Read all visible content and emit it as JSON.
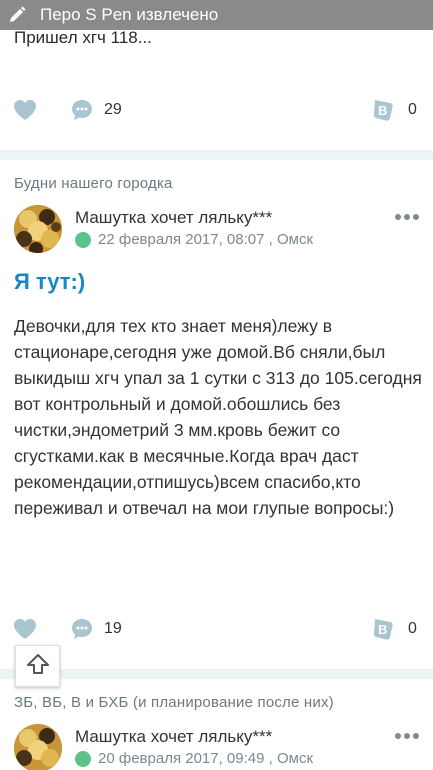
{
  "toast": {
    "text": "Перо S Pen извлечено",
    "icon": "pen-icon"
  },
  "prev_post": {
    "text": "Пришел хгч 118...",
    "comments": "29",
    "votes": "0"
  },
  "post": {
    "category": "Будни нашего городка",
    "author": "Машутка хочет ляльку***",
    "meta": "22 февраля 2017, 08:07 , Омск",
    "title": "Я тут:)",
    "body": "Девочки,для тех кто знает меня)лежу в стационаре,сегодня уже домой.Вб сняли,был выкидыш хгч упал за 1 сутки с 313 до 105.сегодня вот контрольный и домой.обошлись без чистки,эндометрий 3 мм.кровь бежит со сгустками.как в месячные.Когда врач даст рекомендации,отпишусь)всем спасибо,кто переживал и отвечал на мои глупые вопросы:)",
    "comments": "19",
    "votes": "0"
  },
  "next_post": {
    "category": "ЗБ, ВБ, В и БХБ (и планирование после них)",
    "author": "Машутка хочет ляльку***",
    "meta": "20 февраля 2017, 09:49 , Омск"
  },
  "colors": {
    "accent": "#1a86c8",
    "online": "#5cc48a",
    "icon": "#a9c5cf",
    "separator": "#eef3f5"
  }
}
